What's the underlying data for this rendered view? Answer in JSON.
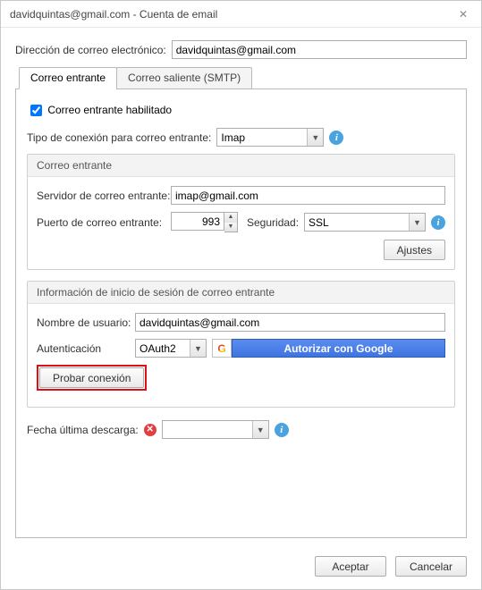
{
  "window": {
    "title": "davidquintas@gmail.com - Cuenta de email"
  },
  "emailAddress": {
    "label": "Dirección de correo electrónico:",
    "value": "davidquintas@gmail.com"
  },
  "tabs": {
    "incoming": "Correo entrante",
    "outgoing": "Correo saliente (SMTP)"
  },
  "incoming": {
    "enabled_label": "Correo entrante habilitado",
    "enabled_checked": true,
    "connection_type_label": "Tipo de conexión para correo entrante:",
    "connection_type_value": "Imap",
    "group_title": "Correo entrante",
    "server_label": "Servidor de correo entrante:",
    "server_value": "imap@gmail.com",
    "port_label": "Puerto de correo entrante:",
    "port_value": "993",
    "security_label": "Seguridad:",
    "security_value": "SSL",
    "settings_btn": "Ajustes"
  },
  "login": {
    "group_title": "Información de inicio de sesión de correo entrante",
    "username_label": "Nombre de usuario:",
    "username_value": "davidquintas@gmail.com",
    "auth_label": "Autenticación",
    "auth_value": "OAuth2",
    "google_btn": "Autorizar con Google",
    "test_btn": "Probar conexión"
  },
  "lastDownload": {
    "label": "Fecha última descarga:",
    "value": ""
  },
  "footer": {
    "ok": "Aceptar",
    "cancel": "Cancelar"
  }
}
